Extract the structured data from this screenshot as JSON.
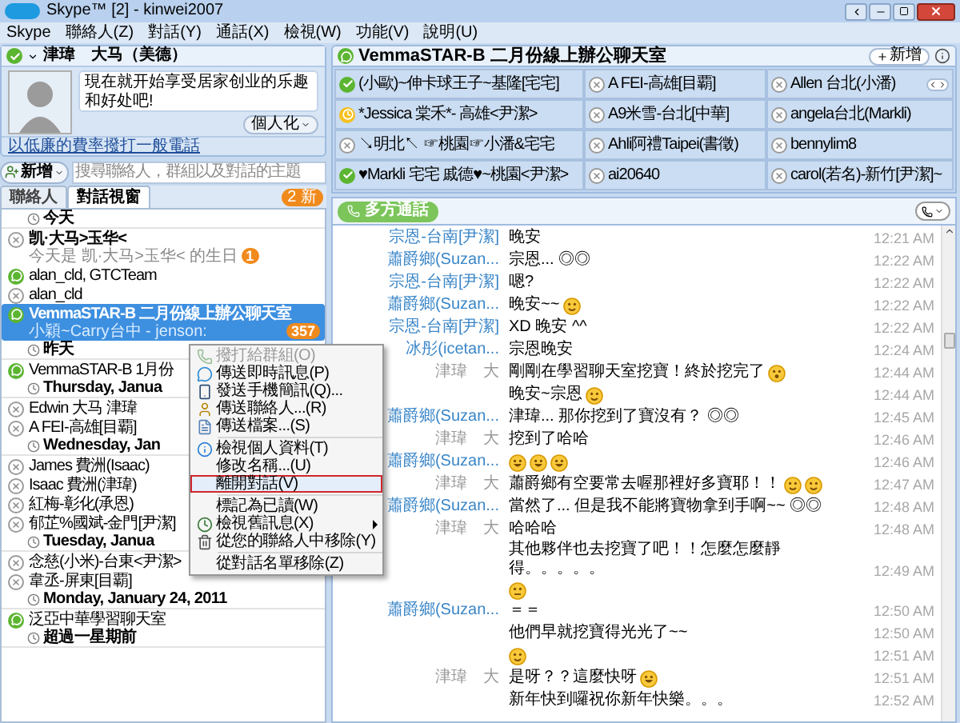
{
  "window": {
    "title": "Skype™ [2] - kinwei2007"
  },
  "menu_bar": [
    "Skype",
    "聯絡人(Z)",
    "對話(Y)",
    "通話(X)",
    "檢視(W)",
    "功能(V)",
    "說明(U)"
  ],
  "profile": {
    "name": "津瑋　大马（美德）",
    "mood": "現在就开始享受居家创业的乐趣和好处吧!",
    "personalize_button": "個人化",
    "call_link": "以低廉的費率撥打一般電話"
  },
  "new_button": "新增",
  "search": {
    "placeholder": "搜尋聯絡人，群組以及對話的主題"
  },
  "tabs": [
    {
      "label": "聯絡人",
      "selected": false
    },
    {
      "label": "對話視窗",
      "selected": true
    }
  ],
  "new_badge": "2 新",
  "conversations": [
    {
      "kind": "header",
      "label": "今天"
    },
    {
      "kind": "contact",
      "title": "凯·大马>玉华<",
      "subtitle": "今天是 凯·大马>玉华< 的生日",
      "badge": "1",
      "bold": true,
      "selected": false
    },
    {
      "kind": "group",
      "title": "alan_cld, GTCTeam",
      "bold": false,
      "selected": false
    },
    {
      "kind": "contact",
      "title": "alan_cld",
      "bold": false,
      "selected": false
    },
    {
      "kind": "group",
      "title": "VemmaSTAR-B 二月份線上辦公聊天室",
      "subtitle": "小穎~Carry台中 - jenson:",
      "badge": "357",
      "bold": true,
      "selected": true
    },
    {
      "kind": "header",
      "label": "昨天"
    },
    {
      "kind": "group",
      "title": "VemmaSTAR-B 1月份",
      "bold": false,
      "selected": false
    },
    {
      "kind": "header",
      "label": "Thursday, Janua"
    },
    {
      "kind": "contact",
      "title": "Edwin 大马 津瑋",
      "bold": false,
      "selected": false
    },
    {
      "kind": "contact",
      "title": "A FEI-高雄[目覇]",
      "bold": false,
      "selected": false
    },
    {
      "kind": "header",
      "label": "Wednesday, Jan"
    },
    {
      "kind": "contact",
      "title": "James 費洲(Isaac)",
      "bold": false,
      "selected": false
    },
    {
      "kind": "contact",
      "title": "Isaac 費洲(津瑋)",
      "bold": false,
      "selected": false
    },
    {
      "kind": "contact",
      "title": "紅梅-彰化(承恩)",
      "bold": false,
      "selected": false
    },
    {
      "kind": "contact",
      "title": "郁芷%國斌-金門[尹潔]",
      "bold": false,
      "selected": false
    },
    {
      "kind": "header",
      "label": "Tuesday, Janua"
    },
    {
      "kind": "contact",
      "title": "念慈(小米)-台東<尹潔>",
      "bold": false,
      "selected": false
    },
    {
      "kind": "contact",
      "title": "韋丞-屏東[目覇]",
      "bold": false,
      "selected": false
    },
    {
      "kind": "header",
      "label": "Monday, January 24, 2011"
    },
    {
      "kind": "group",
      "title": "泛亞中華學習聊天室",
      "bold": false,
      "selected": false
    },
    {
      "kind": "header",
      "label": "超過一星期前"
    }
  ],
  "context_menu": [
    {
      "kind": "phone",
      "label": "撥打給群組(O)",
      "disabled": true,
      "selected": false,
      "submenu": false
    },
    {
      "kind": "chat",
      "label": "傳送即時訊息(P)",
      "disabled": false,
      "selected": false,
      "submenu": false
    },
    {
      "kind": "mobile",
      "label": "發送手機簡訊(Q)...",
      "disabled": false,
      "selected": false,
      "submenu": false
    },
    {
      "kind": "contact",
      "label": "傳送聯絡人...(R)",
      "disabled": false,
      "selected": false,
      "submenu": false
    },
    {
      "kind": "file",
      "label": "傳送檔案...(S)",
      "disabled": false,
      "selected": false,
      "submenu": false
    },
    {
      "kind": "separator"
    },
    {
      "kind": "info",
      "label": "檢視個人資料(T)",
      "disabled": false,
      "selected": false,
      "submenu": false
    },
    {
      "kind": "plain",
      "label": "修改名稱...(U)",
      "disabled": false,
      "selected": false,
      "submenu": false
    },
    {
      "kind": "plain",
      "label": "離開對話(V)",
      "disabled": false,
      "selected": true,
      "submenu": false
    },
    {
      "kind": "separator"
    },
    {
      "kind": "plain",
      "label": "標記為已讀(W)",
      "disabled": false,
      "selected": false,
      "submenu": false
    },
    {
      "kind": "clock",
      "label": "檢視舊訊息(X)",
      "disabled": false,
      "selected": false,
      "submenu": true
    },
    {
      "kind": "trash",
      "label": "從您的聯絡人中移除(Y)",
      "disabled": false,
      "selected": false,
      "submenu": false
    },
    {
      "kind": "separator"
    },
    {
      "kind": "plain",
      "label": "從對話名單移除(Z)",
      "disabled": false,
      "selected": false,
      "submenu": false
    }
  ],
  "chat": {
    "title": "VemmaSTAR-B 二月份線上辦公聊天室",
    "add_button": "新增",
    "call_button": "多方通話",
    "participants": [
      {
        "name": "(小歐)~伸卡球王子~基隆[宅宅]",
        "kind": "online"
      },
      {
        "name": "A FEI-高雄[目覇]",
        "kind": "offline"
      },
      {
        "name": "Allen 台北(小潘)",
        "kind": "offline"
      },
      {
        "name": "*Jessica 棠禾*- 高雄<尹潔>",
        "kind": "away"
      },
      {
        "name": "A9米雪-台北[中華]",
        "kind": "offline"
      },
      {
        "name": "angela台北(Markli)",
        "kind": "offline"
      },
      {
        "name": "↘明北↖ ☞桃園☞小潘&宅宅",
        "kind": "offline"
      },
      {
        "name": "Ahli阿禮Taipei(書徵)",
        "kind": "offline"
      },
      {
        "name": "bennylim8",
        "kind": "offline"
      },
      {
        "name": "♥Markli 宅宅 戚德♥~桃園<尹潔>",
        "kind": "online"
      },
      {
        "name": "ai20640",
        "kind": "offline"
      },
      {
        "name": "carol(若名)-新竹[尹潔]~",
        "kind": "offline"
      }
    ],
    "messages": [
      {
        "sender": {
          "name": "宗恩-台南[尹潔]",
          "self": false
        },
        "text": "晚安",
        "time": "12:21 AM"
      },
      {
        "sender": {
          "name": "蕭爵鄉(Suzan...",
          "self": false
        },
        "text": "宗恩... ◎◎",
        "time": "12:22 AM"
      },
      {
        "sender": {
          "name": "宗恩-台南[尹潔]",
          "self": false
        },
        "text": "嗯?",
        "time": "12:22 AM"
      },
      {
        "sender": {
          "name": "蕭爵鄉(Suzan...",
          "self": false
        },
        "text": "晚安~~",
        "emojis": [
          {
            "kind": "wink"
          }
        ],
        "time": "12:22 AM"
      },
      {
        "sender": {
          "name": "宗恩-台南[尹潔]",
          "self": false
        },
        "text": "XD 晚安 ^^",
        "time": "12:22 AM"
      },
      {
        "sender": {
          "name": "冰彤(icetan...",
          "self": false
        },
        "text": "宗恩晚安",
        "time": "12:24 AM"
      },
      {
        "sender": {
          "name": "津瑋　大",
          "self": true
        },
        "text": "剛剛在學習聊天室挖寶！終於挖完了",
        "emojis": [
          {
            "kind": "sweat"
          }
        ],
        "time": "12:44 AM"
      },
      {
        "text": "晚安~宗恩",
        "emojis": [
          {
            "kind": "wink"
          }
        ],
        "time": "12:44 AM"
      },
      {
        "sender": {
          "name": "蕭爵鄉(Suzan...",
          "self": false
        },
        "text": "津瑋... 那你挖到了寶沒有？ ◎◎",
        "time": "12:45 AM"
      },
      {
        "sender": {
          "name": "津瑋　大",
          "self": true
        },
        "text": "挖到了哈哈",
        "time": "12:46 AM"
      },
      {
        "sender": {
          "name": "蕭爵鄉(Suzan...",
          "self": false
        },
        "emojis": [
          {
            "kind": "laugh"
          },
          {
            "kind": "laugh"
          },
          {
            "kind": "laugh"
          }
        ],
        "time": "12:46 AM"
      },
      {
        "sender": {
          "name": "津瑋　大",
          "self": true
        },
        "text": "蕭爵鄉有空要常去喔那裡好多寶耶！！",
        "emojis": [
          {
            "kind": "wink"
          },
          {
            "kind": "wink"
          }
        ],
        "time": "12:47 AM"
      },
      {
        "sender": {
          "name": "蕭爵鄉(Suzan...",
          "self": false
        },
        "text": "當然了... 但是我不能將寶物拿到手啊~~ ◎◎",
        "time": "12:48 AM"
      },
      {
        "sender": {
          "name": "津瑋　大",
          "self": true
        },
        "text": "哈哈哈",
        "time": "12:48 AM"
      },
      {
        "text": "其他夥伴也去挖寶了吧！！怎麼怎麼靜得。。。。。",
        "emojis": [
          {
            "kind": "bored"
          }
        ],
        "time": "12:49 AM"
      },
      {
        "sender": {
          "name": "蕭爵鄉(Suzan...",
          "self": false
        },
        "text": "＝＝",
        "time": "12:50 AM"
      },
      {
        "text": "他們早就挖寶得光光了~~",
        "time": "12:50 AM"
      },
      {
        "emojis": [
          {
            "kind": "wink"
          }
        ],
        "time": "12:51 AM"
      },
      {
        "sender": {
          "name": "津瑋　大",
          "self": true
        },
        "text": "是呀？？這麼快呀",
        "emojis": [
          {
            "kind": "laugh"
          }
        ],
        "time": "12:51 AM"
      },
      {
        "text": "新年快到囉祝你新年快樂。。。",
        "time": "12:52 AM"
      }
    ]
  }
}
